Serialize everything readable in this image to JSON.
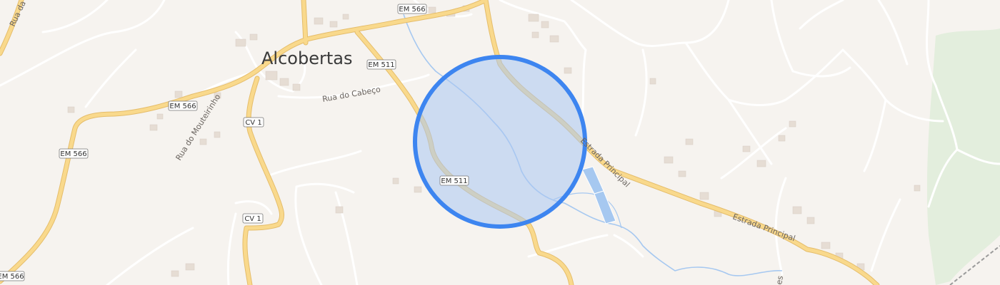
{
  "map": {
    "town_label": "Alcobertas",
    "shields": [
      {
        "id": "em566-top",
        "text": "EM 566"
      },
      {
        "id": "em511-north",
        "text": "EM 511"
      },
      {
        "id": "em566-mid",
        "text": "EM 566"
      },
      {
        "id": "cv1-north",
        "text": "CV 1"
      },
      {
        "id": "em566-west",
        "text": "EM 566"
      },
      {
        "id": "em511-south",
        "text": "EM 511"
      },
      {
        "id": "cv1-south",
        "text": "CV 1"
      },
      {
        "id": "em566-bottom",
        "text": "EM 566"
      }
    ],
    "streets": {
      "rua_do_cabeco": "Rua do Cabeço",
      "rua_do_mouteirinho": "Rua do Mouteirinho",
      "estrada_principal_1": "Estrada Principal",
      "estrada_principal_2": "Estrada Principal",
      "rua_da": "Rua da",
      "partial_es": "es"
    },
    "colors": {
      "background": "#f6f3ef",
      "major_road": "#f9d98c",
      "major_road_casing": "#e5bd6b",
      "minor_road": "#ffffff",
      "water": "#a6c8f0",
      "location_fill": "#a9c7f2",
      "location_ring": "#3d85f0",
      "park": "#e3eedd",
      "building": "#ebe3dc"
    }
  }
}
